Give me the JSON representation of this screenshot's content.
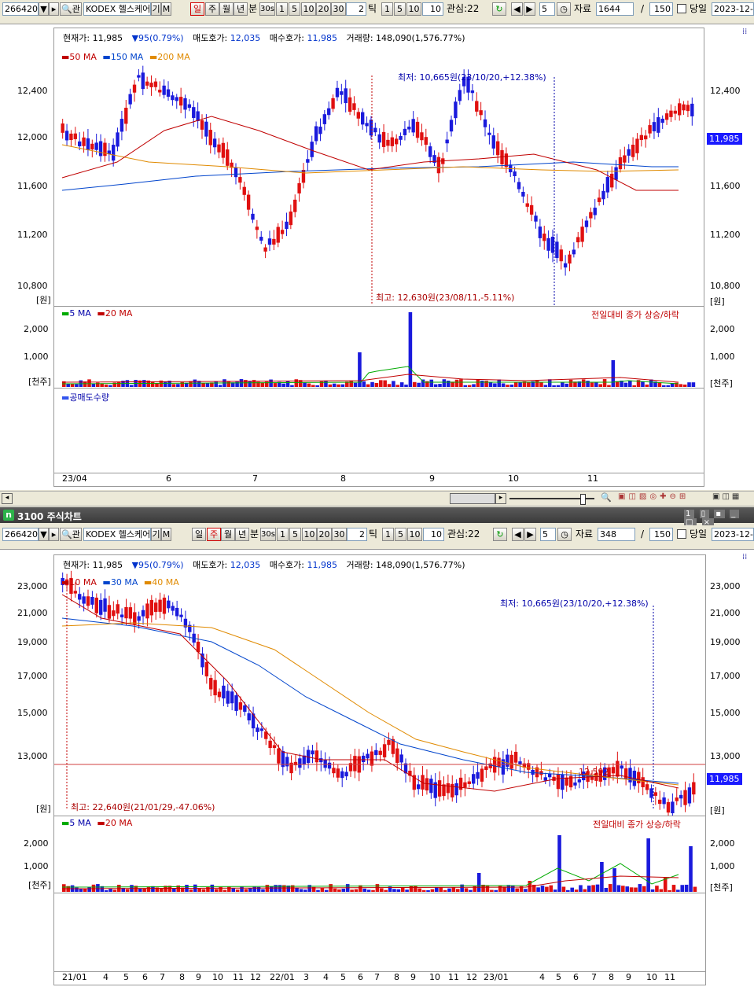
{
  "toolbar_top": {
    "code": "266420",
    "name": "KODEX 헬스케어",
    "type_label": "기",
    "m_label": "M",
    "period_tabs": [
      "일",
      "주",
      "월",
      "년",
      "분"
    ],
    "active_period": "일",
    "sec": "30s",
    "minute_opts": [
      "1",
      "5",
      "10",
      "20",
      "30"
    ],
    "tick_value": "2",
    "tick_label": "틱",
    "tick_opts": [
      "1",
      "5",
      "10"
    ],
    "tick_input": "10",
    "watch_label": "관심:22",
    "count_input": "5",
    "data_label": "자료",
    "data_value": "1644",
    "slash": "/",
    "page_size": "150",
    "today_label": "당일",
    "date": "2023-12-0"
  },
  "chart1": {
    "info": {
      "current_label": "현재가:",
      "current": "11,985",
      "change": "95(0.79%)",
      "ask_label": "매도호가:",
      "ask": "12,035",
      "bid_label": "매수호가:",
      "bid": "11,985",
      "vol_label": "거래량:",
      "vol": "148,090(1,576.77%)"
    },
    "legend": [
      {
        "label": "50 MA",
        "color": "#c00000"
      },
      {
        "label": "150 MA",
        "color": "#0044cc"
      },
      {
        "label": "200 MA",
        "color": "#e08a00"
      }
    ],
    "y_ticks": [
      "12,400",
      "12,000",
      "11,600",
      "11,200",
      "10,800"
    ],
    "unit": "[원]",
    "price_tag": "11,985",
    "low_note": "최저: 10,665원(23/10/20,+12.38%)",
    "high_note": "최고: 12,630원(23/08/11,-5.11%)",
    "vol_legend": [
      {
        "label": "5 MA",
        "color": "#00aa00"
      },
      {
        "label": "20 MA",
        "color": "#c00000"
      }
    ],
    "vol_note": "전일대비 종가 상승/하락",
    "vol_ticks": [
      "2,000",
      "1,000"
    ],
    "vol_unit": "[천주]",
    "short_label": "공매도수량",
    "x_labels": [
      "23/04",
      "6",
      "7",
      "8",
      "9",
      "10",
      "11"
    ]
  },
  "titlebar2": {
    "icon": "n",
    "title": "3100 주식차트"
  },
  "toolbar_bottom": {
    "code": "266420",
    "name": "KODEX 헬스케어",
    "type_label": "기",
    "m_label": "M",
    "period_tabs": [
      "일",
      "주",
      "월",
      "년",
      "분"
    ],
    "active_period": "주",
    "sec": "30s",
    "minute_opts": [
      "1",
      "5",
      "10",
      "20",
      "30"
    ],
    "tick_value": "2",
    "tick_label": "틱",
    "tick_opts": [
      "1",
      "5",
      "10"
    ],
    "tick_input": "10",
    "watch_label": "관심:22",
    "count_input": "5",
    "data_label": "자료",
    "data_value": "348",
    "slash": "/",
    "page_size": "150",
    "today_label": "당일",
    "date": "2023-12-"
  },
  "chart2": {
    "info": {
      "current_label": "현재가:",
      "current": "11,985",
      "change": "95(0.79%)",
      "ask_label": "매도호가:",
      "ask": "12,035",
      "bid_label": "매수호가:",
      "bid": "11,985",
      "vol_label": "거래량:",
      "vol": "148,090(1,576.77%)"
    },
    "legend": [
      {
        "label": "10 MA",
        "color": "#c00000"
      },
      {
        "label": "30 MA",
        "color": "#0044cc"
      },
      {
        "label": "40 MA",
        "color": "#e08a00"
      }
    ],
    "y_ticks": [
      "23,000",
      "21,000",
      "19,000",
      "17,000",
      "15,000",
      "13,000"
    ],
    "unit": "[원]",
    "price_tag": "11,985",
    "line_value": "12,592",
    "low_note": "최저: 10,665원(23/10/20,+12.38%)",
    "high_note": "최고: 22,640원(21/01/29,-47.06%)",
    "vol_legend": [
      {
        "label": "5 MA",
        "color": "#00aa00"
      },
      {
        "label": "20 MA",
        "color": "#c00000"
      }
    ],
    "vol_note": "전일대비 종가 상승/하락",
    "vol_ticks": [
      "2,000",
      "1,000"
    ],
    "vol_unit": "[천주]",
    "x_labels": [
      "21/01",
      "4",
      "5",
      "6",
      "7",
      "8",
      "9",
      "10",
      "11",
      "12",
      "22/01",
      "3",
      "4",
      "5",
      "6",
      "7",
      "8",
      "9",
      "10",
      "11",
      "12",
      "23/01",
      "4",
      "5",
      "6",
      "7",
      "8",
      "9",
      "10",
      "11"
    ]
  }
}
